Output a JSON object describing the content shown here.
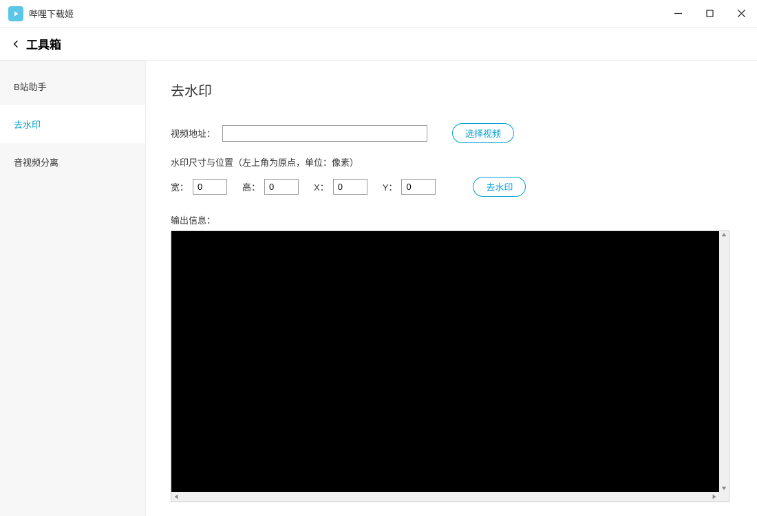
{
  "window": {
    "title": "哔哩下载姬"
  },
  "header": {
    "title": "工具箱"
  },
  "sidebar": {
    "items": [
      {
        "label": "B站助手",
        "active": false
      },
      {
        "label": "去水印",
        "active": true
      },
      {
        "label": "音视频分离",
        "active": false
      }
    ]
  },
  "main": {
    "page_title": "去水印",
    "video_path_label": "视频地址：",
    "video_path_value": "",
    "select_video_btn": "选择视频",
    "dim_section_label": "水印尺寸与位置（左上角为原点，单位：像素）",
    "width_label": "宽：",
    "width_value": "0",
    "height_label": "高：",
    "height_value": "0",
    "x_label": "X：",
    "x_value": "0",
    "y_label": "Y：",
    "y_value": "0",
    "dewatermark_btn": "去水印",
    "output_label": "输出信息："
  },
  "colors": {
    "accent": "#00a1d6",
    "icon_bg": "#5bc6e8"
  }
}
